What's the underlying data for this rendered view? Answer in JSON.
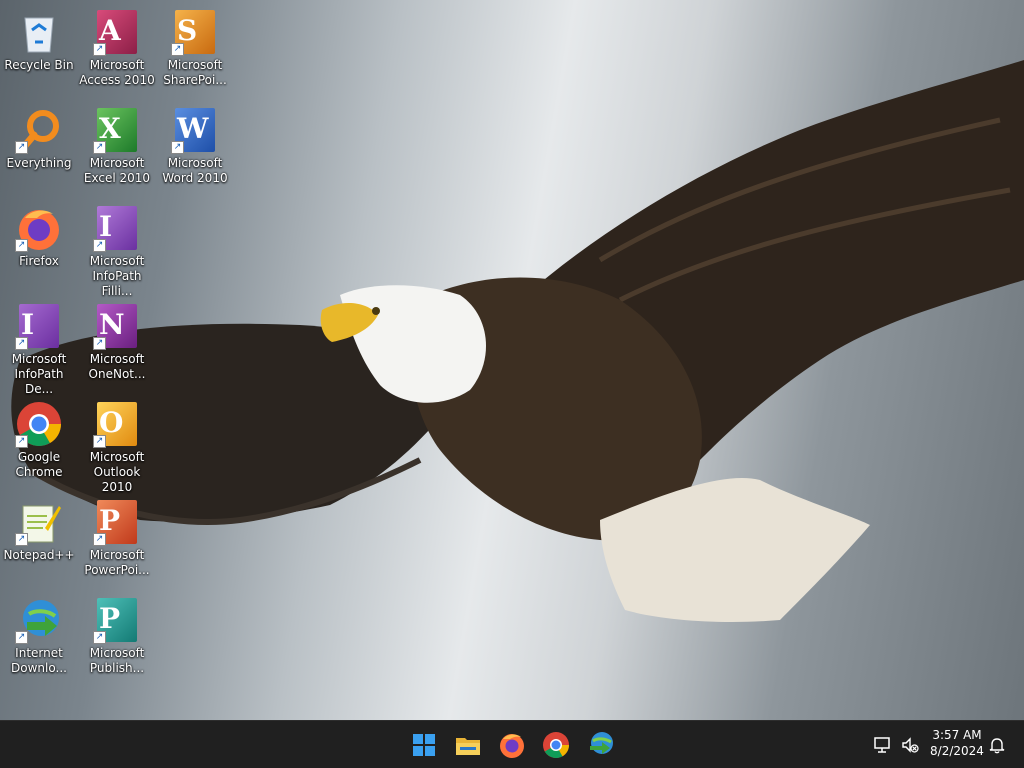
{
  "desktop": {
    "icons": [
      {
        "label": "Recycle Bin"
      },
      {
        "label": "Microsoft\nAccess 2010"
      },
      {
        "label": "Microsoft\nSharePoi..."
      },
      {
        "label": "Everything"
      },
      {
        "label": "Microsoft\nExcel 2010"
      },
      {
        "label": "Microsoft\nWord 2010"
      },
      {
        "label": "Firefox"
      },
      {
        "label": "Microsoft\nInfoPath Filli..."
      },
      {
        "label": "Microsoft\nInfoPath De..."
      },
      {
        "label": "Microsoft\nOneNot..."
      },
      {
        "label": "Google\nChrome"
      },
      {
        "label": "Microsoft\nOutlook 2010"
      },
      {
        "label": "Notepad++"
      },
      {
        "label": "Microsoft\nPowerPoi..."
      },
      {
        "label": "Internet\nDownlo..."
      },
      {
        "label": "Microsoft\nPublish..."
      }
    ]
  },
  "taskbar": {
    "time": "3:57 AM",
    "date": "8/2/2024",
    "pinned": [
      "windows-start",
      "file-explorer",
      "firefox",
      "chrome",
      "internet-download-manager"
    ]
  }
}
